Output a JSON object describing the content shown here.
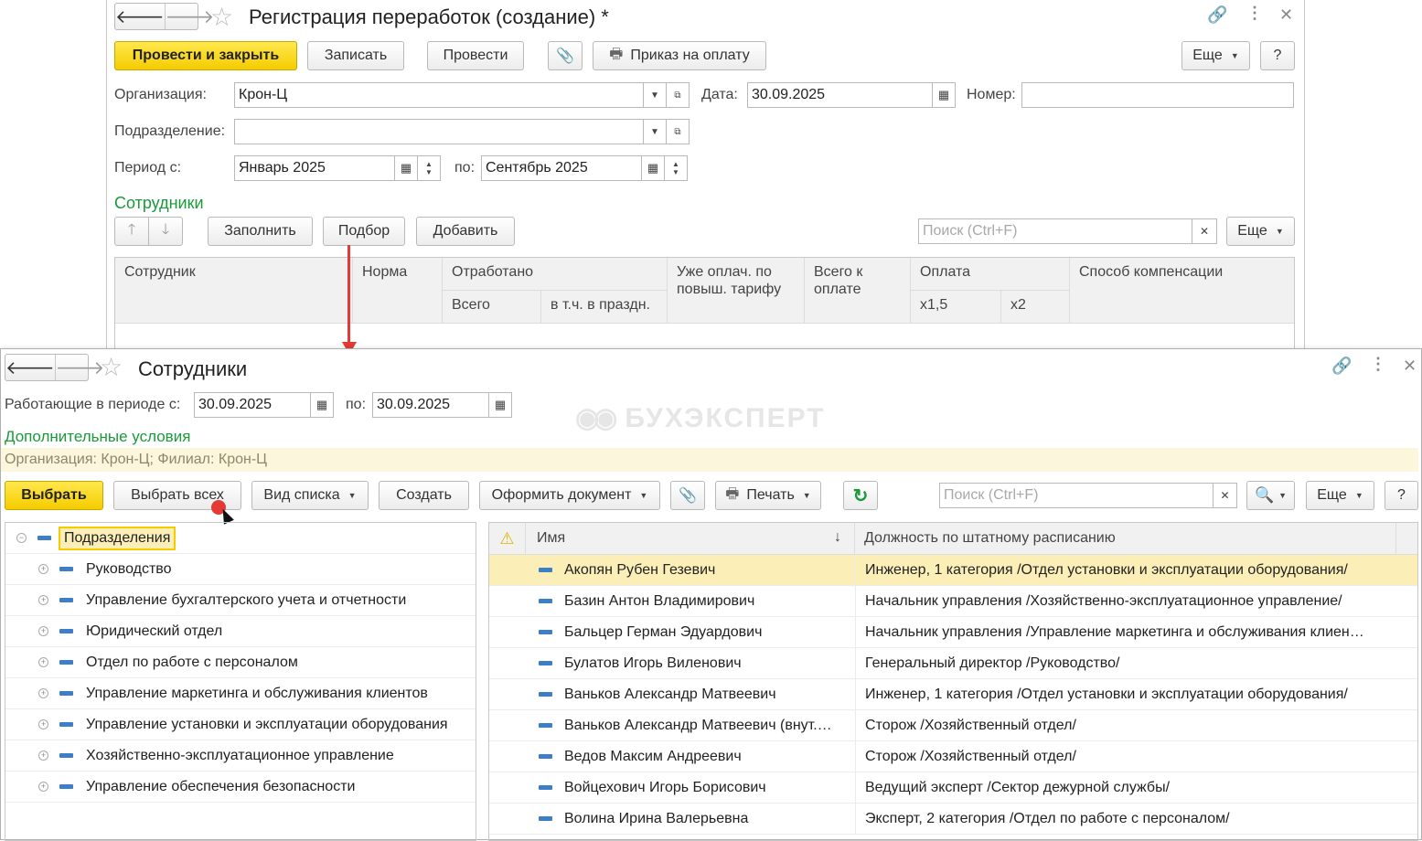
{
  "reg": {
    "title": "Регистрация переработок (создание) *",
    "buttons": {
      "post_close": "Провести и закрыть",
      "save": "Записать",
      "post": "Провести",
      "pay_order": "Приказ на оплату",
      "more": "Еще",
      "help": "?"
    },
    "fields": {
      "org_label": "Организация:",
      "org_value": "Крон-Ц",
      "date_label": "Дата:",
      "date_value": "30.09.2025",
      "number_label": "Номер:",
      "dept_label": "Подразделение:",
      "period_label": "Период с:",
      "period_from": "Январь 2025",
      "period_to_label": "по:",
      "period_to": "Сентябрь 2025"
    },
    "section_title": "Сотрудники",
    "table_buttons": {
      "fill": "Заполнить",
      "pick": "Подбор",
      "add": "Добавить",
      "more": "Еще",
      "search_placeholder": "Поиск (Ctrl+F)"
    },
    "columns": {
      "employee": "Сотрудник",
      "norm": "Норма",
      "worked": "Отработано",
      "worked_total": "Всего",
      "worked_holiday": "в т.ч. в праздн.",
      "already_paid": "Уже оплач. по повыш. тарифу",
      "total_to_pay": "Всего к оплате",
      "payment": "Оплата",
      "pay_x15": "x1,5",
      "pay_x2": "x2",
      "compensation": "Способ компенсации"
    }
  },
  "sel": {
    "title": "Сотрудники",
    "period_label": "Работающие в периоде с:",
    "period_from": "30.09.2025",
    "period_to_label": "по:",
    "period_to": "30.09.2025",
    "watermark": "БУХЭКСПЕРТ",
    "extra_conditions": "Дополнительные условия",
    "filter_text": "Организация: Крон-Ц; Филиал: Крон-Ц",
    "buttons": {
      "select": "Выбрать",
      "select_all": "Выбрать всех",
      "list_view": "Вид списка",
      "create": "Создать",
      "make_doc": "Оформить документ",
      "print": "Печать",
      "more": "Еще",
      "help": "?",
      "search_placeholder": "Поиск (Ctrl+F)"
    },
    "tree": {
      "root": "Подразделения",
      "items": [
        "Руководство",
        "Управление бухгалтерского учета и отчетности",
        "Юридический отдел",
        "Отдел по работе с персоналом",
        "Управление маркетинга и обслуживания клиентов",
        "Управление установки и эксплуатации оборудования",
        "Хозяйственно-эксплуатационное управление",
        "Управление обеспечения безопасности"
      ]
    },
    "list": {
      "col_name": "Имя",
      "col_position": "Должность по штатному расписанию",
      "sort_icon": "arrow-down",
      "rows": [
        {
          "name": "Акопян Рубен Гезевич",
          "position": "Инженер, 1 категория /Отдел установки и эксплуатации оборудования/"
        },
        {
          "name": "Базин Антон Владимирович",
          "position": "Начальник управления /Хозяйственно-эксплуатационное управление/"
        },
        {
          "name": "Бальцер Герман Эдуардович",
          "position": "Начальник управления /Управление маркетинга и обслуживания клиен…"
        },
        {
          "name": "Булатов Игорь Виленович",
          "position": "Генеральный директор /Руководство/"
        },
        {
          "name": "Ваньков Александр Матвеевич",
          "position": "Инженер, 1 категория /Отдел установки и эксплуатации оборудования/"
        },
        {
          "name": "Ваньков Александр Матвеевич (внут.…",
          "position": "Сторож /Хозяйственный отдел/"
        },
        {
          "name": "Ведов Максим Андреевич",
          "position": "Сторож /Хозяйственный отдел/"
        },
        {
          "name": "Войцехович Игорь Борисович",
          "position": "Ведущий эксперт /Сектор дежурной службы/"
        },
        {
          "name": "Волина Ирина Валерьевна",
          "position": "Эксперт, 2 категория /Отдел по работе с персоналом/"
        }
      ]
    }
  },
  "colors": {
    "accent_yellow": "#f5cc00",
    "section_green": "#1a9a3a",
    "arrow_red": "#e53935",
    "selected_row": "#fbefb7"
  }
}
